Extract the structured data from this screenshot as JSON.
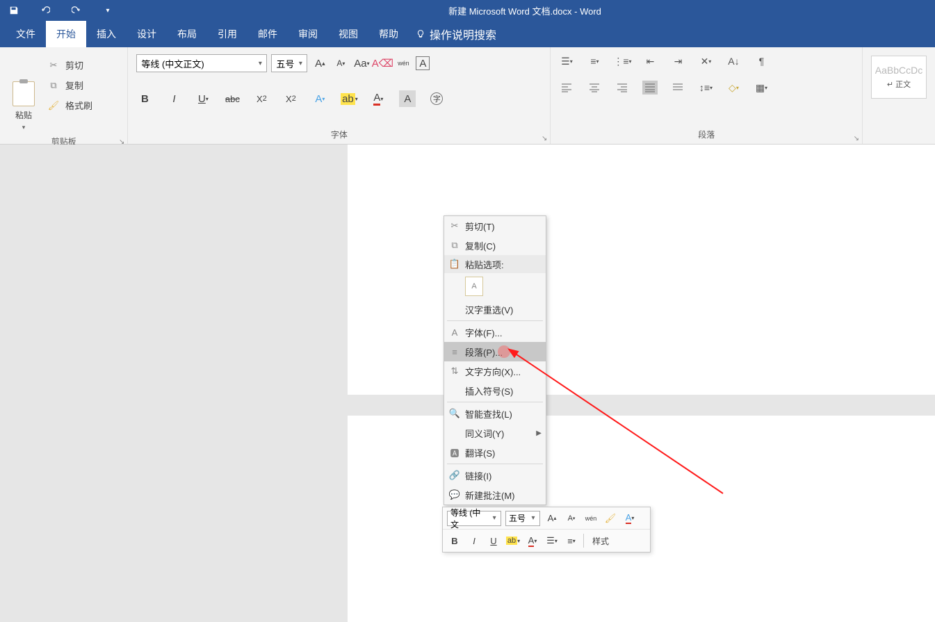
{
  "title": "新建 Microsoft Word 文档.docx  -  Word",
  "tabs": [
    "文件",
    "开始",
    "插入",
    "设计",
    "布局",
    "引用",
    "邮件",
    "审阅",
    "视图",
    "帮助"
  ],
  "tell_me": "操作说明搜索",
  "clipboard": {
    "paste": "粘贴",
    "cut": "剪切",
    "copy": "复制",
    "format_painter": "格式刷",
    "group_label": "剪贴板"
  },
  "font": {
    "name": "等线 (中文正文)",
    "size": "五号",
    "group_label": "字体"
  },
  "paragraph": {
    "group_label": "段落"
  },
  "styles": {
    "sample": "AaBbCcDc",
    "name": "↵ 正文"
  },
  "context_menu": {
    "cut": "剪切(T)",
    "copy": "复制(C)",
    "paste_options": "粘贴选项:",
    "hanzi": "汉字重选(V)",
    "font": "字体(F)...",
    "paragraph": "段落(P)...",
    "text_direction": "文字方向(X)...",
    "insert_symbol": "插入符号(S)",
    "smart_lookup": "智能查找(L)",
    "synonyms": "同义词(Y)",
    "translate": "翻译(S)",
    "link": "链接(I)",
    "new_comment": "新建批注(M)"
  },
  "mini_toolbar": {
    "font": "等线 (中文",
    "size": "五号",
    "styles": "样式"
  }
}
